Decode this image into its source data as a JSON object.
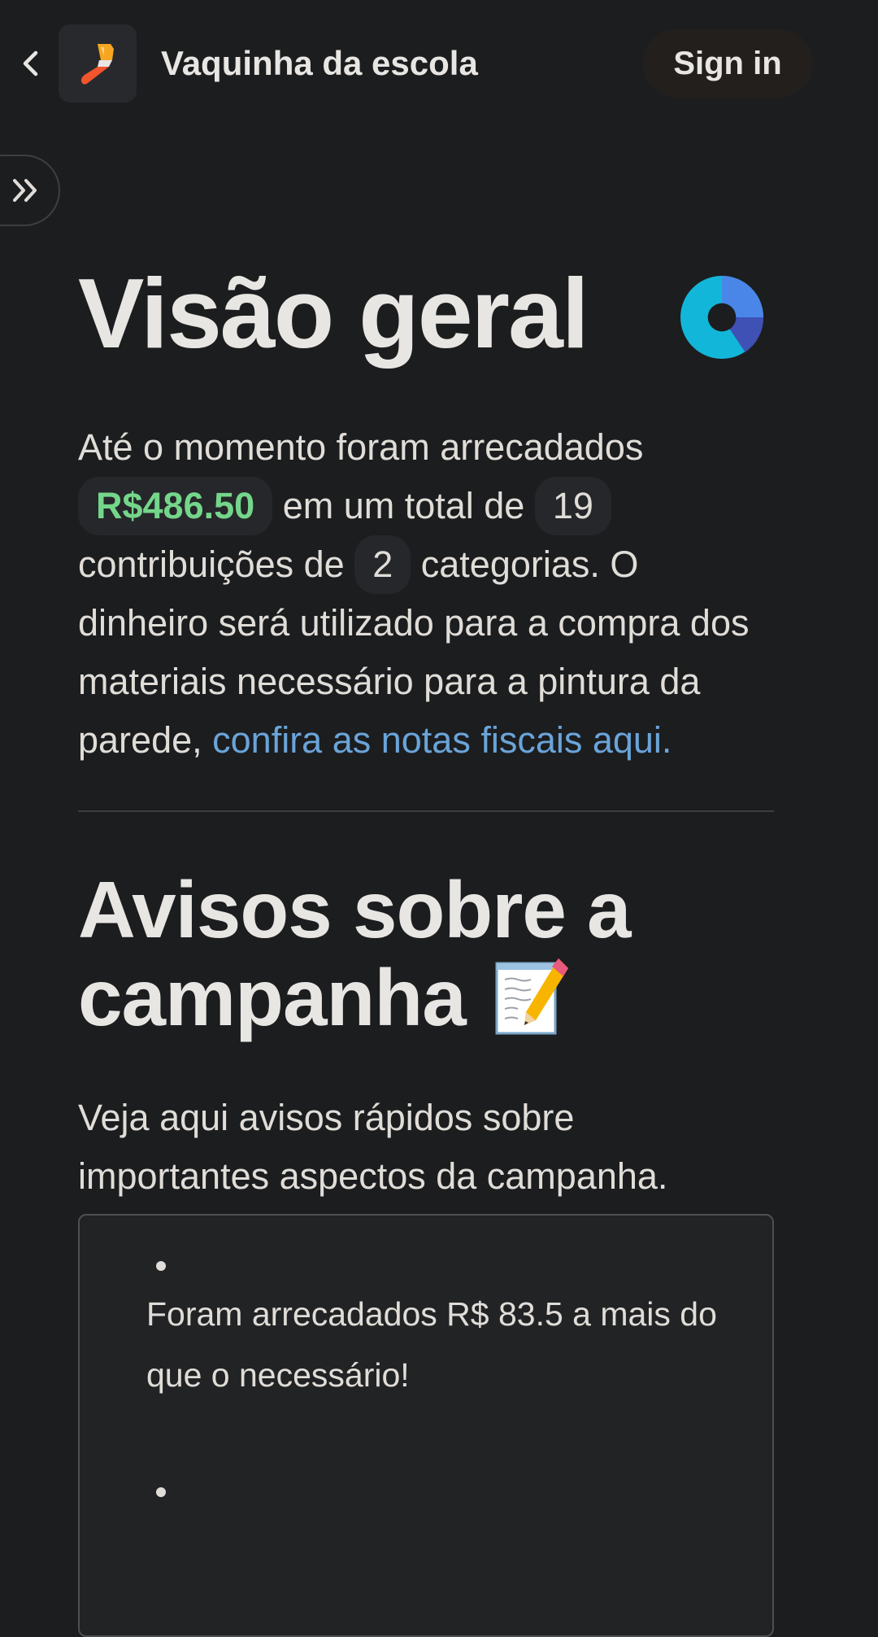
{
  "header": {
    "title": "Vaquinha da escola",
    "signin_label": "Sign in",
    "app_icon": "paintbrush-icon"
  },
  "main": {
    "title": "Visão geral",
    "summary": {
      "part1": "Até o momento foram arrecadados",
      "amount": "R$486.50",
      "part2": "em um total de",
      "contributions": "19",
      "part3": "contribuições de",
      "categories": "2",
      "part4": "categorias. O dinheiro será utilizado para a compra dos materiais necessário para a pintura da parede,",
      "link": "confira as notas fiscais aqui."
    },
    "notices_title": "Avisos sobre a campanha",
    "notices_intro": "Veja aqui avisos rápidos sobre importantes aspectos da campanha.",
    "notices": [
      {
        "text": "Foram arrecadados R$ 83.5 a mais do que o necessário!"
      },
      {
        "text": ""
      }
    ]
  },
  "colors": {
    "background": "#1c1d1f",
    "money": "#74d68a",
    "link": "#6aa4d9"
  }
}
